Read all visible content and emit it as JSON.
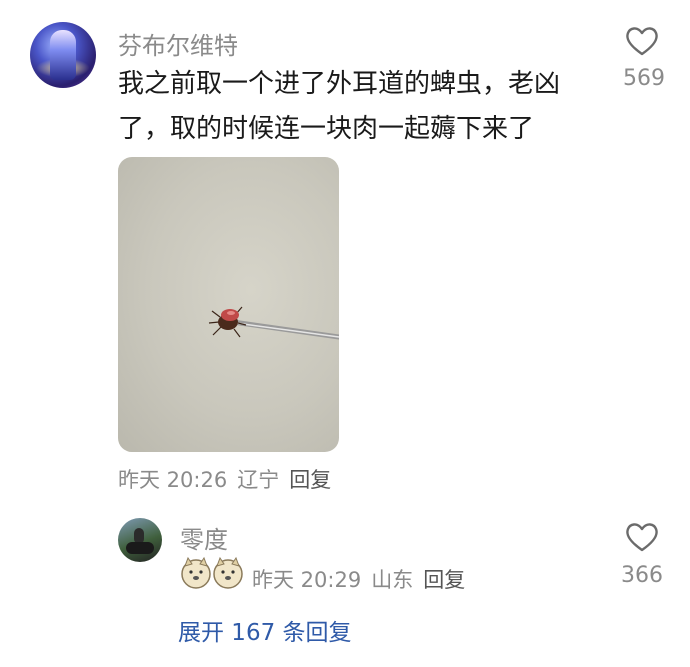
{
  "comment1": {
    "username": "芬布尔维特",
    "text": "我之前取一个进了外耳道的蜱虫，老凶了，取的时候连一块肉一起薅下来了",
    "likes": "569",
    "time": "昨天 20:26",
    "location": "辽宁",
    "reply_label": "回复"
  },
  "comment2": {
    "username": "零度",
    "likes": "366",
    "time": "昨天 20:29",
    "location": "山东",
    "reply_label": "回复"
  },
  "expand_replies": "展开 167 条回复",
  "colors": {
    "link": "#2f5aa8",
    "muted": "#8a8a8a",
    "text": "#1a1a1a"
  },
  "icons": [
    "heart-icon",
    "doge-emoji-icon"
  ]
}
